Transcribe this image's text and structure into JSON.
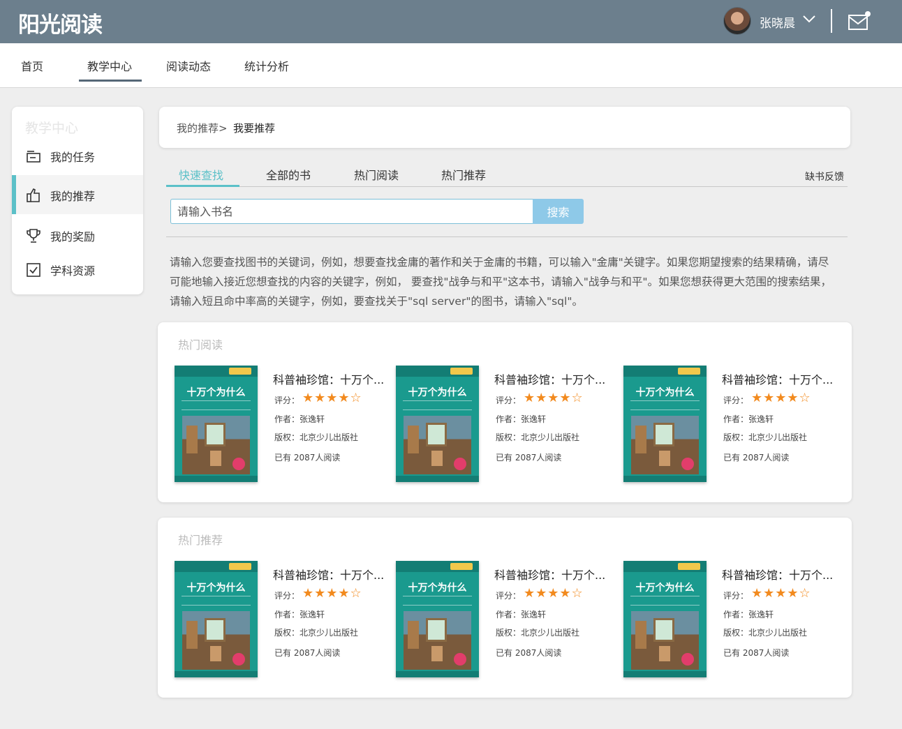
{
  "app": {
    "logo": "阳光阅读"
  },
  "user": {
    "name": "张晓晨"
  },
  "nav": {
    "items": [
      "首页",
      "教学中心",
      "阅读动态",
      "统计分析"
    ],
    "active": "教学中心"
  },
  "sidebar": {
    "title": "教学中心",
    "items": [
      {
        "label": "我的任务",
        "icon": "task-icon"
      },
      {
        "label": "我的推荐",
        "icon": "thumbs-up-icon"
      },
      {
        "label": "我的奖励",
        "icon": "trophy-icon"
      },
      {
        "label": "学科资源",
        "icon": "checkbox-icon"
      }
    ],
    "active": "我的推荐"
  },
  "breadcrumb": {
    "parent": "我的推荐>",
    "current": "我要推荐"
  },
  "tabs": {
    "items": [
      "快速查找",
      "全部的书",
      "热门阅读",
      "热门推荐"
    ],
    "active": "快速查找",
    "feedback": "缺书反馈"
  },
  "search": {
    "placeholder": "请输入书名",
    "button": "搜索"
  },
  "help_text": "请输入您要查找图书的关键词，例如，想要查找金庸的著作和关于金庸的书籍，可以输入\"金庸\"关键字。如果您期望搜索的结果精确，请尽可能地输入接近您想查找的内容的关键字，例如， 要查找\"战争与和平\"这本书，请输入\"战争与和平\"。如果您想获得更大范围的搜索结果， 请输入短且命中率高的关键字，例如，要查找关于\"sql server\"的图书，请输入\"sql\"。",
  "sections": [
    {
      "title": "热门阅读",
      "books": [
        {
          "title": "科普袖珍馆：十万个...",
          "cover_title": "十万个为什么",
          "rating_label": "评分：",
          "rating": 4,
          "rating_max": 5,
          "author": "作者：张逸轩",
          "publisher": "版权：北京少儿出版社",
          "readers": "已有 2087人阅读"
        },
        {
          "title": "科普袖珍馆：十万个...",
          "cover_title": "十万个为什么",
          "rating_label": "评分：",
          "rating": 4,
          "rating_max": 5,
          "author": "作者：张逸轩",
          "publisher": "版权：北京少儿出版社",
          "readers": "已有 2087人阅读"
        },
        {
          "title": "科普袖珍馆：十万个...",
          "cover_title": "十万个为什么",
          "rating_label": "评分：",
          "rating": 4,
          "rating_max": 5,
          "author": "作者：张逸轩",
          "publisher": "版权：北京少儿出版社",
          "readers": "已有 2087人阅读"
        }
      ]
    },
    {
      "title": "热门推荐",
      "books": [
        {
          "title": "科普袖珍馆：十万个...",
          "cover_title": "十万个为什么",
          "rating_label": "评分：",
          "rating": 4,
          "rating_max": 5,
          "author": "作者：张逸轩",
          "publisher": "版权：北京少儿出版社",
          "readers": "已有 2087人阅读"
        },
        {
          "title": "科普袖珍馆：十万个...",
          "cover_title": "十万个为什么",
          "rating_label": "评分：",
          "rating": 4,
          "rating_max": 5,
          "author": "作者：张逸轩",
          "publisher": "版权：北京少儿出版社",
          "readers": "已有 2087人阅读"
        },
        {
          "title": "科普袖珍馆：十万个...",
          "cover_title": "十万个为什么",
          "rating_label": "评分：",
          "rating": 4,
          "rating_max": 5,
          "author": "作者：张逸轩",
          "publisher": "版权：北京少儿出版社",
          "readers": "已有 2087人阅读"
        }
      ]
    }
  ],
  "colors": {
    "topbar": "#6c7f8d",
    "accent": "#5bc0c8",
    "search_button": "#8ec9e8",
    "star": "#f28a1e"
  }
}
